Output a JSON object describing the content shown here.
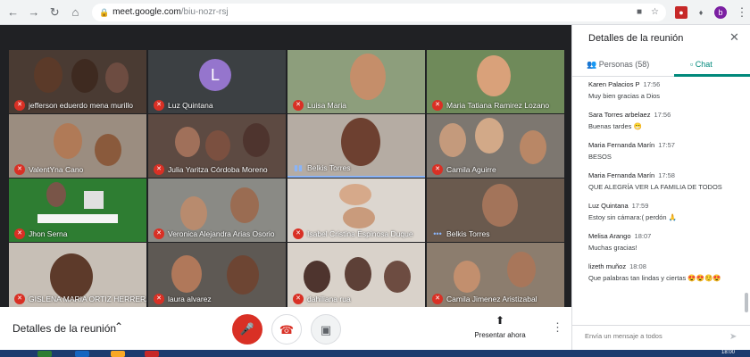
{
  "browser": {
    "url_host": "meet.google.com",
    "url_path": "/biu-nozr-rsj",
    "profile_initial": "b"
  },
  "meeting": {
    "tiles": [
      {
        "name": "jefferson eduerdo mena murillo",
        "mic": "muted"
      },
      {
        "name": "Luz Quintana",
        "mic": "muted",
        "avatar_initial": "L"
      },
      {
        "name": "Luisa Maria",
        "mic": "muted"
      },
      {
        "name": "Maria Tatiana Ramirez Lozano",
        "mic": "muted"
      },
      {
        "name": "ValentYna Cano",
        "mic": "muted"
      },
      {
        "name": "Julia Yaritza Córdoba Moreno",
        "mic": "muted"
      },
      {
        "name": "Belkis Torres",
        "mic": "speaking"
      },
      {
        "name": "Camila Aguirre",
        "mic": "muted"
      },
      {
        "name": "Jhon Serna",
        "mic": "muted"
      },
      {
        "name": "Veronica Alejandra Arias Osorio",
        "mic": "muted"
      },
      {
        "name": "Isabel Cristina Espinosa Duque",
        "mic": "muted"
      },
      {
        "name": "Belkis Torres",
        "mic": "dots"
      },
      {
        "name": "GISLENA MARIA ORTIZ HERRERA",
        "mic": "muted"
      },
      {
        "name": "laura alvarez",
        "mic": "muted"
      },
      {
        "name": "dahiliana rua",
        "mic": "muted"
      },
      {
        "name": "Camila Jimenez Aristizabal",
        "mic": "muted"
      }
    ]
  },
  "bottom_bar": {
    "details_label": "Detalles de la reunión",
    "present_label": "Presentar ahora"
  },
  "panel": {
    "title": "Detalles de la reunión",
    "tab_people": "Personas (58)",
    "tab_chat": "Chat",
    "messages": [
      {
        "author": "Karen Palacios P",
        "time": "17:56",
        "text": "Muy bien gracias a Dios"
      },
      {
        "author": "Sara Torres arbelaez",
        "time": "17:56",
        "text": "Buenas tardes 😁"
      },
      {
        "author": "Maria Fernanda Marín",
        "time": "17:57",
        "text": "BESOS"
      },
      {
        "author": "Maria Fernanda Marín",
        "time": "17:58",
        "text": "QUE ALEGRÍA VER LA FAMILIA DE TODOS"
      },
      {
        "author": "Luz Quintana",
        "time": "17:59",
        "text": "Estoy sin cámara:( perdón 🙏"
      },
      {
        "author": "Melisa Arango",
        "time": "18:07",
        "text": "Muchas gracias!"
      },
      {
        "author": "lizeth muñoz",
        "time": "18:08",
        "text": "Que palabras tan lindas y ciertas 😍😍☺️😍"
      }
    ],
    "compose_placeholder": "Envía un mensaje a todos"
  },
  "taskbar": {
    "clock": "18:00"
  },
  "colors": {
    "accent": "#00897b",
    "danger": "#d93025",
    "stage_bg": "#202124"
  }
}
